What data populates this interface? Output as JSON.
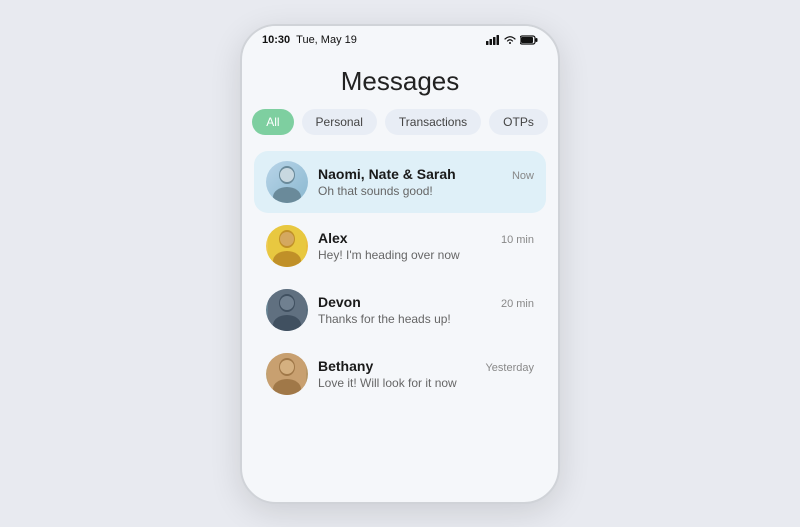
{
  "statusBar": {
    "time": "10:30",
    "date": "Tue, May 19"
  },
  "page": {
    "title": "Messages"
  },
  "filters": [
    {
      "id": "all",
      "label": "All",
      "active": true
    },
    {
      "id": "personal",
      "label": "Personal",
      "active": false
    },
    {
      "id": "transactions",
      "label": "Transactions",
      "active": false
    },
    {
      "id": "otps",
      "label": "OTPs",
      "active": false
    }
  ],
  "messages": [
    {
      "id": "naomi",
      "name": "Naomi, Nate & Sarah",
      "preview": "Oh that sounds good!",
      "time": "Now",
      "highlighted": true,
      "avatarClass": "avatar-naomi",
      "emoji": "👩"
    },
    {
      "id": "alex",
      "name": "Alex",
      "preview": "Hey! I'm heading over now",
      "time": "10 min",
      "highlighted": false,
      "avatarClass": "avatar-alex",
      "emoji": "👩"
    },
    {
      "id": "devon",
      "name": "Devon",
      "preview": "Thanks for the heads up!",
      "time": "20 min",
      "highlighted": false,
      "avatarClass": "avatar-devon",
      "emoji": "🧑"
    },
    {
      "id": "bethany",
      "name": "Bethany",
      "preview": "Love it! Will look for it now",
      "time": "Yesterday",
      "highlighted": false,
      "avatarClass": "avatar-bethany",
      "emoji": "👩"
    }
  ]
}
